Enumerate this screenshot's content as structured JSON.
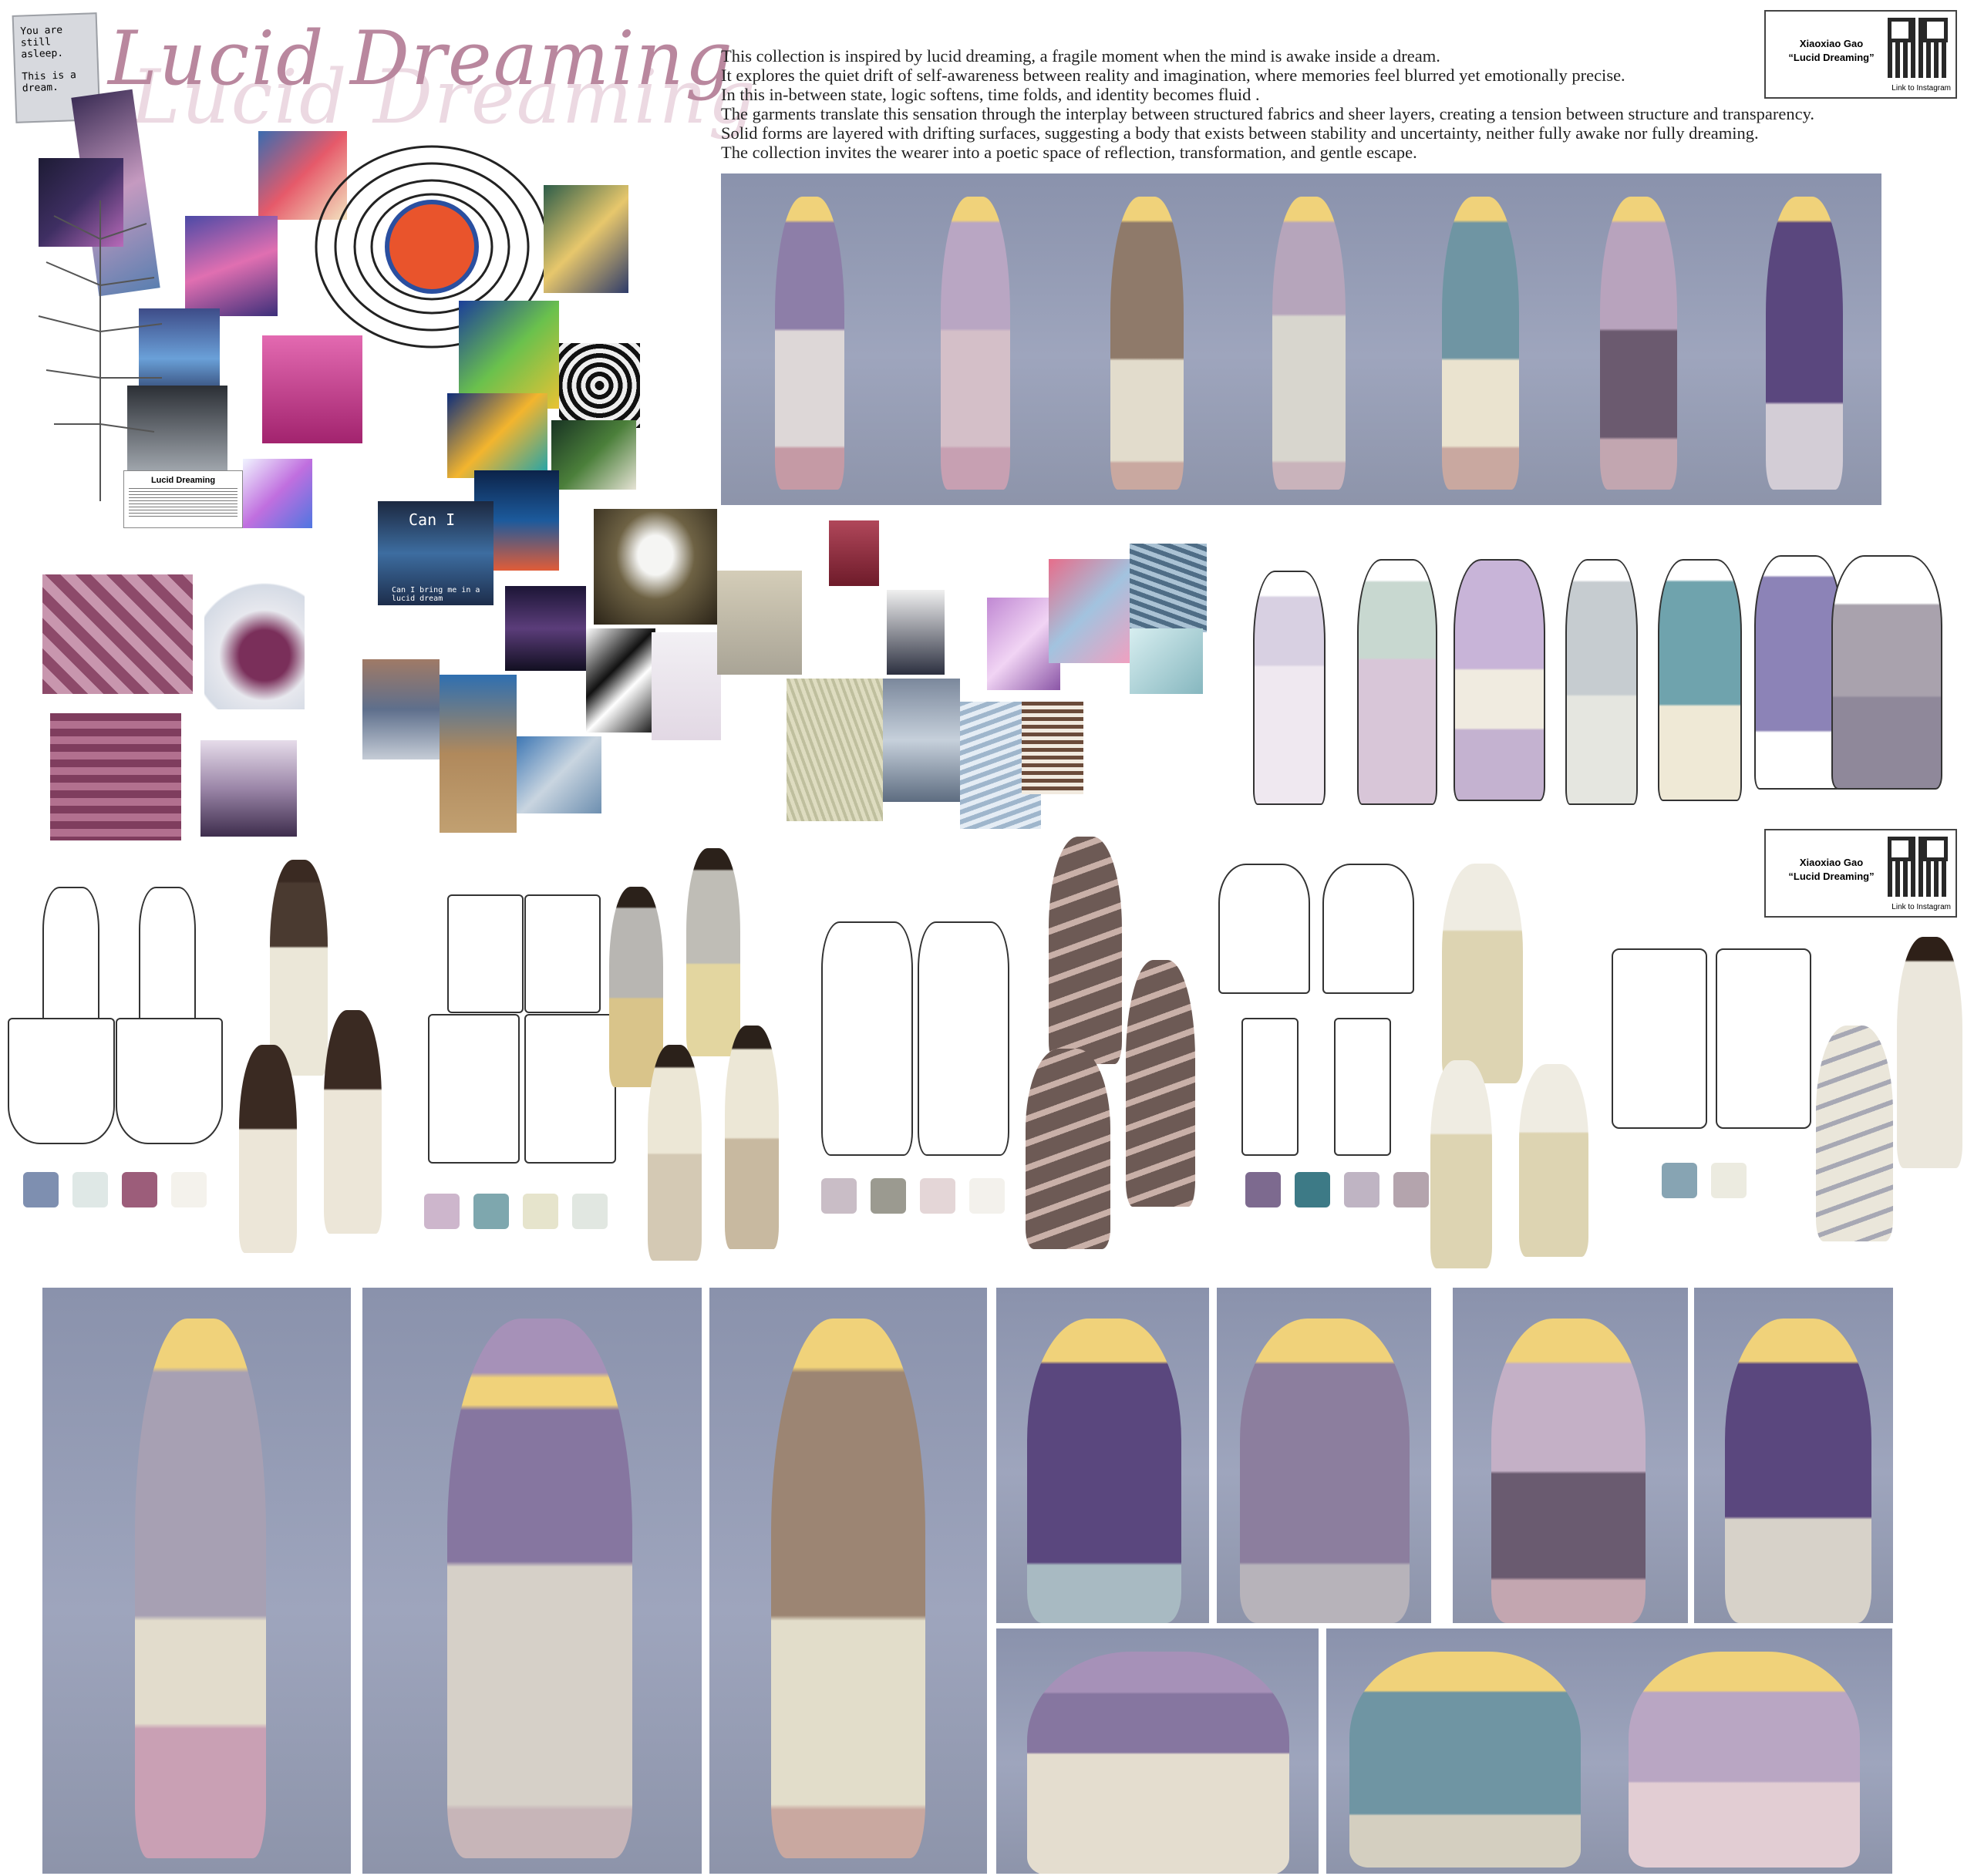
{
  "title": "Lucid Dreaming",
  "note": {
    "line1": "You are still asleep.",
    "line2": "This is a dream."
  },
  "description": [
    "This collection is inspired by lucid dreaming, a fragile moment when the mind is awake inside a dream.",
    "It explores the quiet drift of self-awareness between reality and imagination, where memories feel blurred yet emotionally precise.",
    "In this in-between state, logic softens, time folds, and identity becomes fluid .",
    "The garments translate this sensation through the interplay between structured fabrics and sheer layers, creating a tension between structure and transparency.",
    "Solid forms are layered with drifting surfaces, suggesting a body that exists between stability and uncertainty, neither fully awake nor fully dreaming.",
    "The collection invites the wearer into a poetic space of reflection, transformation, and gentle escape."
  ],
  "card": {
    "designer": "Xiaoxiao Gao",
    "collection": "“Lucid Dreaming”",
    "link": "Link to Instagram"
  },
  "collage_text": {
    "can_i": "Can I",
    "can_i_sub": "Can I bring me in a lucid dream",
    "lucid_card": "Lucid Dreaming"
  },
  "colors": {
    "title": "#b9879e",
    "backdrop": "#939ab2",
    "swatches": [
      [
        "#7e8fb0",
        "#dfe8e6",
        "#9c5d7a",
        "#f4f2ec"
      ],
      [
        "#cdb6cc",
        "#7ea7ae",
        "#e6e4cc",
        "#e1e7e1"
      ],
      [
        "#c9bdc6",
        "#9b9a90",
        "#e4d6d7",
        "#f3f1ec"
      ],
      [
        "#7d6a8f",
        "#3d7a86",
        "#bfb4c3",
        "#b4a4ad"
      ],
      [
        "#87a4b3",
        "#ecebe0"
      ]
    ]
  }
}
